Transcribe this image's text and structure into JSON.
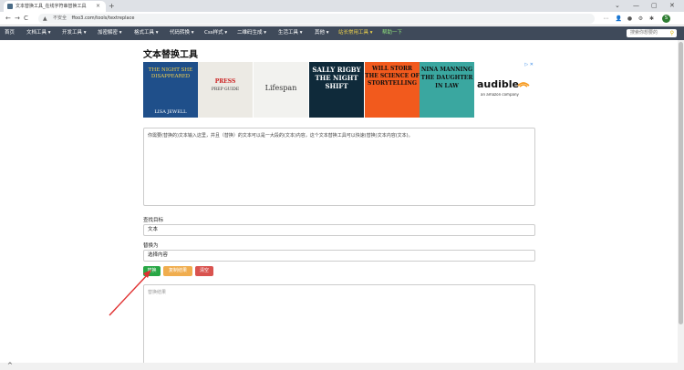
{
  "browser": {
    "tab_title": "文本替换工具_在线字符串替换工具",
    "tab_close": "×",
    "new_tab": "+",
    "window_controls": [
      "⌄",
      "—",
      "▢",
      "✕"
    ],
    "nav": {
      "back": "←",
      "forward": "→",
      "reload": "C",
      "home": "⌂"
    },
    "address": {
      "warning_icon": "▲",
      "insecure_label": "不安全",
      "url": "ffoo3.com/tools/textreplace"
    },
    "extension_icons": [
      "⋯",
      "👤",
      "●",
      "⚙",
      "✱"
    ],
    "profile_initial": "S"
  },
  "site_nav": {
    "items": [
      {
        "label": "首页",
        "style": "normal"
      },
      {
        "label": "文档工具 ▾",
        "style": "normal"
      },
      {
        "label": "开发工具 ▾",
        "style": "normal"
      },
      {
        "label": "加密解密 ▾",
        "style": "normal"
      },
      {
        "label": "格式工具 ▾",
        "style": "normal"
      },
      {
        "label": "代码转换 ▾",
        "style": "normal"
      },
      {
        "label": "Css样式 ▾",
        "style": "normal"
      },
      {
        "label": "二维码生成 ▾",
        "style": "normal"
      },
      {
        "label": "生活工具 ▾",
        "style": "normal"
      },
      {
        "label": "其他 ▾",
        "style": "normal"
      },
      {
        "label": "站长常用工具 ▾",
        "style": "hl"
      },
      {
        "label": "帮助一下",
        "style": "hl2"
      }
    ],
    "search_placeholder": "搜索你想要的",
    "search_icon": "⚲"
  },
  "page": {
    "title": "文本替换工具",
    "ad": {
      "choice_label": "▷ ✕",
      "books": [
        {
          "title": "THE NIGHT SHE DISAPPEARED",
          "author": "LISA JEWELL",
          "bg": "#1f4f8a",
          "fg": "#f6d24b"
        },
        {
          "title": "PRESS",
          "author": "PREP GUIDE",
          "bg": "#eceae4",
          "fg": "#333"
        },
        {
          "title": "Lifespan",
          "author": "",
          "bg": "#f2f2ef",
          "fg": "#333"
        },
        {
          "title": "SALLY RIGBY THE NIGHT SHIFT",
          "author": "",
          "bg": "#0f2a3a",
          "fg": "#ffffff"
        },
        {
          "title": "WILL STORR THE SCIENCE OF STORYTELLING",
          "author": "",
          "bg": "#f25a1d",
          "fg": "#111"
        },
        {
          "title": "NINA MANNING THE DAUGHTER IN LAW",
          "author": "",
          "bg": "#3aa7a0",
          "fg": "#111"
        }
      ],
      "brand": "audible",
      "brand_sub": "an amazon company"
    },
    "source_text": "你需要(替换的)文本输入这里，并且（替换）的文本可以是一大段的(文本)内容，这个文本替换工具可以快速(替换)文本内容(文本)。",
    "find_label": "查找目标",
    "find_value": "文本",
    "replace_label": "替换为",
    "replace_value": "选择内容",
    "buttons": {
      "replace": "替换",
      "copy": "复制结果",
      "clear": "清空"
    },
    "result_placeholder": "替换结果"
  },
  "colors": {
    "nav_bg": "#3f4a5a",
    "btn_replace": "#28a745",
    "btn_copy": "#f0ad4e",
    "btn_clear": "#d9534f",
    "arrow": "#e03030"
  }
}
